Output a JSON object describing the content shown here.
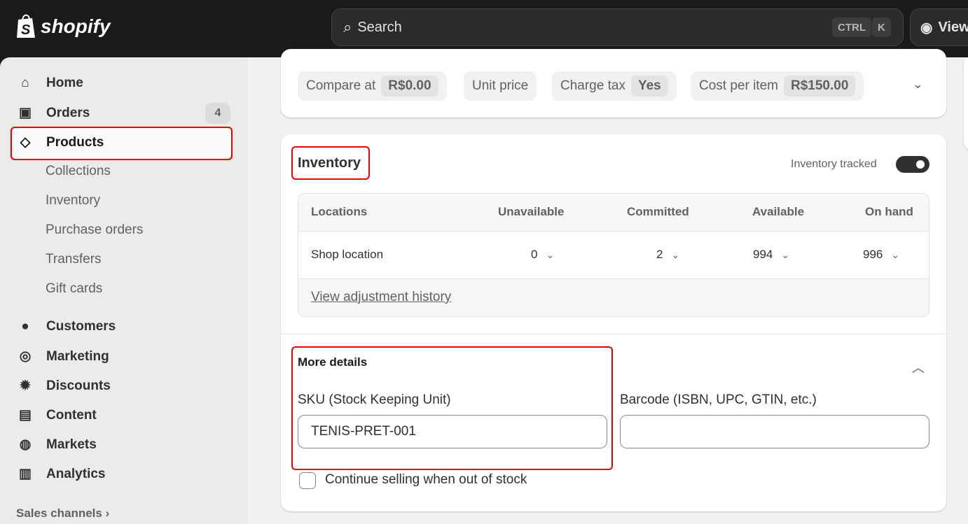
{
  "topbar": {
    "brand": "shopify",
    "search_placeholder": "Search",
    "kbd1": "CTRL",
    "kbd2": "K",
    "view": "View"
  },
  "sidebar": {
    "items": [
      {
        "label": "Home"
      },
      {
        "label": "Orders",
        "badge": "4"
      },
      {
        "label": "Products"
      }
    ],
    "subitems": [
      "Collections",
      "Inventory",
      "Purchase orders",
      "Transfers",
      "Gift cards"
    ],
    "items2": [
      {
        "label": "Customers"
      },
      {
        "label": "Marketing"
      },
      {
        "label": "Discounts"
      },
      {
        "label": "Content"
      },
      {
        "label": "Markets"
      },
      {
        "label": "Analytics"
      }
    ],
    "sales_channels": "Sales channels"
  },
  "pricing": {
    "compare_label": "Compare at",
    "compare_value": "R$0.00",
    "unit_price": "Unit price",
    "charge_tax_label": "Charge tax",
    "charge_tax_value": "Yes",
    "cost_label": "Cost per item",
    "cost_value": "R$150.00"
  },
  "inventory": {
    "title": "Inventory",
    "tracked_label": "Inventory tracked",
    "tracked": true,
    "columns": [
      "Locations",
      "Unavailable",
      "Committed",
      "Available",
      "On hand"
    ],
    "row": {
      "location": "Shop location",
      "unavailable": "0",
      "committed": "2",
      "available": "994",
      "on_hand": "996"
    },
    "history_link": "View adjustment history"
  },
  "more_details": {
    "title": "More details",
    "sku_label": "SKU (Stock Keeping Unit)",
    "sku_value": "TENIS-PRET-001",
    "barcode_label": "Barcode (ISBN, UPC, GTIN, etc.)",
    "barcode_value": "",
    "continue_selling": "Continue selling when out of stock",
    "continue_selling_checked": false
  },
  "colors": {
    "topbar": "#1a1a1a",
    "highlight": "#e00000"
  }
}
